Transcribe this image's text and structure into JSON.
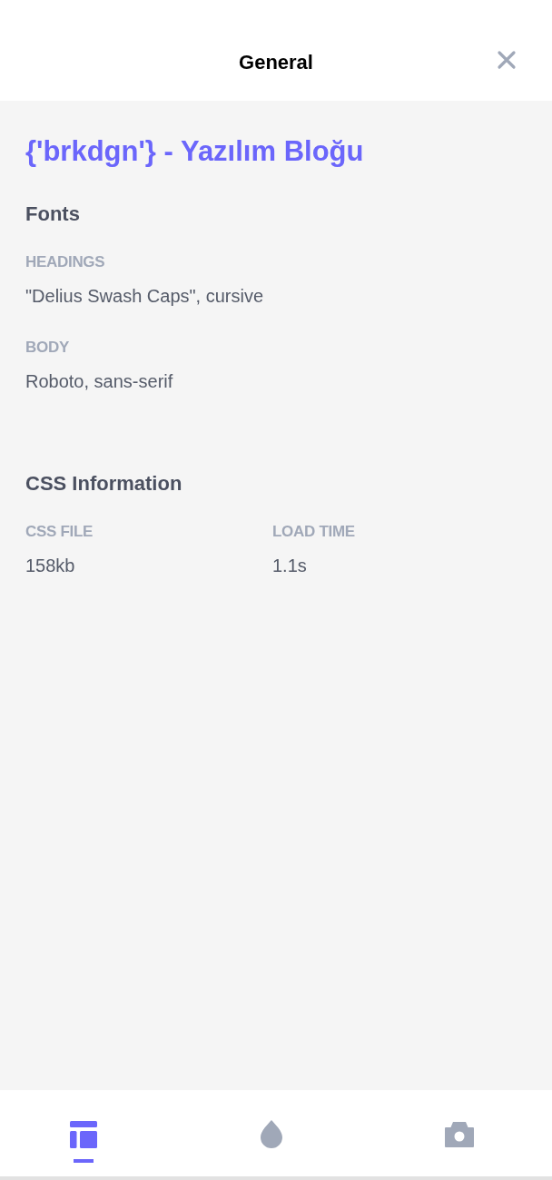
{
  "header": {
    "title": "General"
  },
  "site_title": "{'brkdgn'} - Yazılım Bloğu",
  "sections": [
    {
      "heading": "Fonts",
      "kind": "stack",
      "fields": [
        {
          "label": "HEADINGS",
          "value": "\"Delius Swash Caps\", cursive"
        },
        {
          "label": "BODY",
          "value": "Roboto, sans-serif"
        }
      ]
    },
    {
      "heading": "CSS Information",
      "kind": "columns",
      "fields": [
        {
          "label": "CSS FILE",
          "value": "158kb"
        },
        {
          "label": "LOAD TIME",
          "value": "1.1s"
        }
      ]
    }
  ],
  "bottom_nav": [
    {
      "kind": "layout",
      "selected": true
    },
    {
      "kind": "color",
      "selected": false
    },
    {
      "kind": "image",
      "selected": false
    }
  ]
}
